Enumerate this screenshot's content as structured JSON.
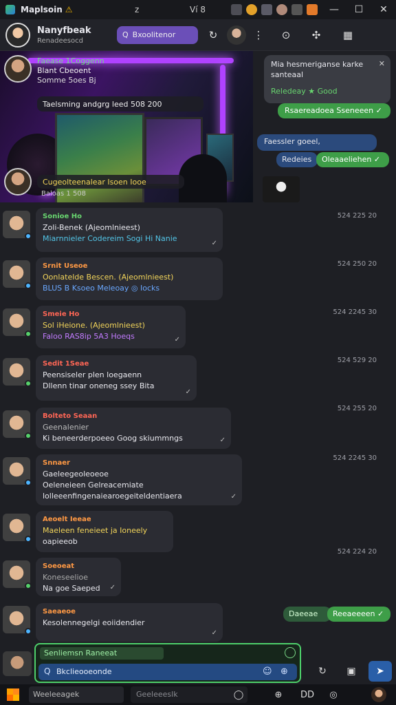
{
  "titlebar": {
    "app_name": "Maplsoin",
    "warn_glyph": "⚠",
    "mid_text": "z",
    "mid_text2": "Ví 8",
    "min": "—",
    "max": "☐",
    "close": "✕"
  },
  "header": {
    "title": "Nanyfbeak",
    "subtitle": "Renadeesocd",
    "search_label": "Bxoolitenor",
    "search_glyph": "Q",
    "icons": [
      "↻",
      "⋮",
      "⊙",
      "✣",
      "▦"
    ]
  },
  "hero": {
    "card1": {
      "line1": "Faease 1Coggenn",
      "line2": "Blant Cbeoent",
      "line3": "Somme 5oes Bj"
    },
    "pill1": "Taelsming andgrg leed   508  200",
    "pill2": "Cugeolteenalear   Isoen   Iooe",
    "pill2_sub": "Baloas 1 508"
  },
  "right_msgs": [
    {
      "text": "Mia hesmeriganse karke  santeaal",
      "sub": "Reledeay ★ Good",
      "close": "✕"
    },
    {
      "text": "Rsaereadoea Sseneeen ✓"
    },
    {
      "text": "Faessler goeel,"
    },
    {
      "text": "Redeies"
    },
    {
      "text": "Oleaaeliehen ✓"
    },
    {
      "text": "Daeeae"
    },
    {
      "text": "Reeaeeeen ✓"
    }
  ],
  "messages": [
    {
      "name": "Sonioe Ho",
      "name_color": "green",
      "line1": "Zoli-Benek (Ajeomlnieest)",
      "line2": "Miarnnieler  Codereim Sogi Hi Nanie",
      "ts": "524  225  20",
      "tick": "✓"
    },
    {
      "name": "Srnit Useoe",
      "name_color": "orange",
      "line1": "Oonlatelde Bescen. (Ajeomlnieest)",
      "line2": "BLUS B Ksoeo  Meleoay  ◎ Iocks",
      "ts": "524  250  20",
      "tick": ""
    },
    {
      "name": "Smeie Ho",
      "name_color": "red",
      "line1": "Sol iHeione. (Ajeomlnieest)",
      "line2": "Faloo  RAS8ip 5A3 Hoeqs",
      "ts": "524  2245  30",
      "tick": "✓"
    },
    {
      "name": "Sedit 1Seae",
      "name_color": "orange",
      "line1": "Peensiseler plen loegaenn",
      "line2": "Dllenn tinar oneneg ssey Bita",
      "ts": "524  529  20",
      "tick": "✓"
    },
    {
      "name": "Bolteto Seaan",
      "name_color": "red",
      "line1": "Geenalenier",
      "line2": "Ki beneerderpoeeo Goog skiummngs",
      "ts": "524  255  20",
      "tick": "✓"
    },
    {
      "name": "Snnaer",
      "name_color": "orange",
      "line1": "Gaeleegeoleoeoe",
      "line2": "Oeleneieen Gelreacemiate",
      "line3": "lolleeenfingenaiearoegeiteldentiaera",
      "ts": "524  2245  30",
      "tick": "✓"
    },
    {
      "name": "Aeoelt Ieeae",
      "name_color": "orange",
      "line1": "Maeleen feneieet  ja  Ioneely",
      "line2": "oapieeob",
      "ts": "524  224  20",
      "tick": ""
    },
    {
      "name": "Soeoeat",
      "name_color": "orange",
      "line1": "Koneseelioe",
      "line2": "Na goe Saeped",
      "ts": "",
      "tick": "✓"
    },
    {
      "name": "Saeaeoe",
      "name_color": "orange",
      "line1": "Kesolennegelgi eoiidendier",
      "line2": "",
      "ts": "",
      "tick": "✓"
    }
  ],
  "composer": {
    "reply_text": "Senliemsn Raneeat",
    "input_value": "Bkclieooeonde",
    "icons": [
      "☺",
      "⊕"
    ]
  },
  "composer_buttons": [
    "↻",
    "▣",
    "➤"
  ],
  "taskbar": {
    "search1": "Weeleeagek",
    "search2": "Geeleeeslk",
    "icons": [
      "◯",
      "⊕",
      "DD",
      "◎",
      "☻"
    ]
  }
}
